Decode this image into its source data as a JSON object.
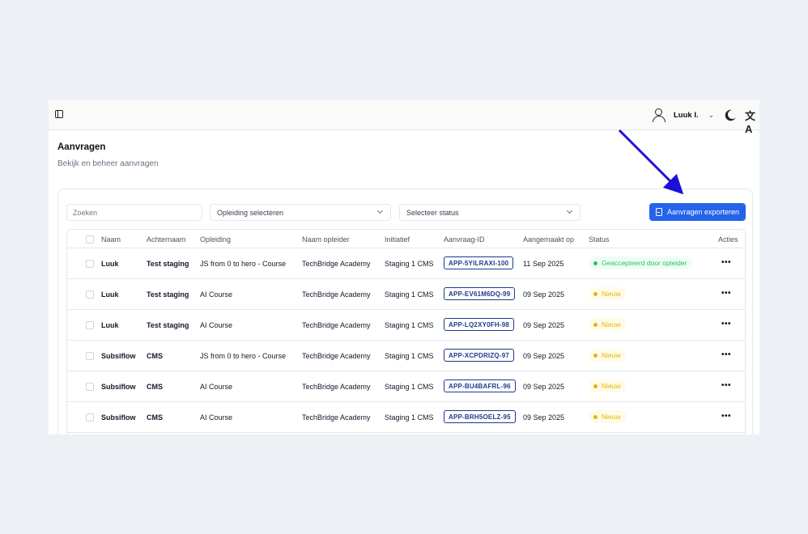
{
  "topbar": {
    "user_name": "Luuk I.",
    "translate_glyph": "文A"
  },
  "page": {
    "title": "Aanvragen",
    "subtitle": "Bekijk en beheer aanvragen"
  },
  "filters": {
    "search_placeholder": "Zoeken",
    "opleiding_select": "Opleiding selecteren",
    "status_select": "Selecteer status",
    "export_label": "Aanvragen exporteren"
  },
  "table": {
    "headers": [
      "Naam",
      "Achternaam",
      "Opleiding",
      "Naam opleider",
      "Initiatief",
      "Aanvraag-ID",
      "Aangemaakt op",
      "Status",
      "Acties"
    ],
    "rows": [
      {
        "naam": "Luuk",
        "achternaam": "Test staging",
        "opleiding": "JS from 0 to hero - Course",
        "opleider": "TechBridge Academy",
        "initiatief": "Staging 1 CMS",
        "id": "APP-5YILRAXI-100",
        "datum": "11 Sep 2025",
        "status": "Geaccepteerd door opleider",
        "status_type": "accepted"
      },
      {
        "naam": "Luuk",
        "achternaam": "Test staging",
        "opleiding": "AI Course",
        "opleider": "TechBridge Academy",
        "initiatief": "Staging 1 CMS",
        "id": "APP-EV61M6DQ-99",
        "datum": "09 Sep 2025",
        "status": "Nieuw",
        "status_type": "new"
      },
      {
        "naam": "Luuk",
        "achternaam": "Test staging",
        "opleiding": "AI Course",
        "opleider": "TechBridge Academy",
        "initiatief": "Staging 1 CMS",
        "id": "APP-LQ2XY0FH-98",
        "datum": "09 Sep 2025",
        "status": "Nieuw",
        "status_type": "new"
      },
      {
        "naam": "Subsiflow",
        "achternaam": "CMS",
        "opleiding": "JS from 0 to hero - Course",
        "opleider": "TechBridge Academy",
        "initiatief": "Staging 1 CMS",
        "id": "APP-XCPDRIZQ-97",
        "datum": "09 Sep 2025",
        "status": "Nieuw",
        "status_type": "new"
      },
      {
        "naam": "Subsiflow",
        "achternaam": "CMS",
        "opleiding": "AI Course",
        "opleider": "TechBridge Academy",
        "initiatief": "Staging 1 CMS",
        "id": "APP-BU4BAFRL-96",
        "datum": "09 Sep 2025",
        "status": "Nieuw",
        "status_type": "new"
      },
      {
        "naam": "Subsiflow",
        "achternaam": "CMS",
        "opleiding": "AI Course",
        "opleider": "TechBridge Academy",
        "initiatief": "Staging 1 CMS",
        "id": "APP-BRH5OELZ-95",
        "datum": "09 Sep 2025",
        "status": "Nieuw",
        "status_type": "new"
      }
    ],
    "actions_glyph": "•••"
  },
  "colors": {
    "accent": "#2563eb",
    "accepted_bg": "#f0fdf4",
    "accepted_fg": "#22c55e",
    "new_bg": "#fefce8",
    "new_fg": "#eab308",
    "arrow": "#1d10d6"
  },
  "icons": [
    "sidebar-toggle-icon",
    "user-icon",
    "chevron-down-icon",
    "moon-icon",
    "translate-icon",
    "file-icon",
    "more-dots-icon",
    "arrow-annotation"
  ]
}
